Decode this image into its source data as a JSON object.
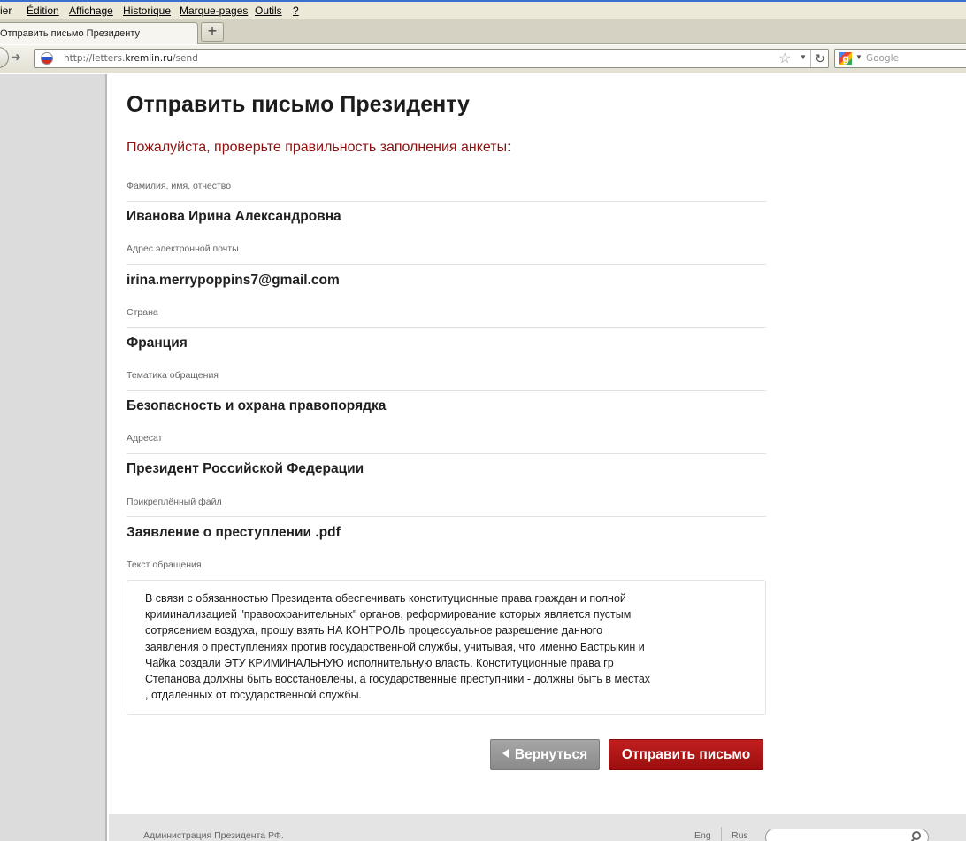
{
  "browser": {
    "menu": [
      "ier",
      "Édition",
      "Affichage",
      "Historique",
      "Marque-pages",
      "Outils",
      "?"
    ],
    "tab_title": "Отправить письмо Президенту",
    "new_tab_label": "+",
    "url_prefix": "http://letters.",
    "url_domain": "kremlin.ru",
    "url_path": "/send",
    "search_placeholder": "Google",
    "site_flag_colors": [
      "#ffffff",
      "#2a56c6",
      "#d52b1e"
    ]
  },
  "page": {
    "title": "Отправить письмо Президенту",
    "notice": "Пожалуйста, проверьте правильность заполнения анкеты:",
    "fields": [
      {
        "label": "Фамилия, имя, отчество",
        "value": "Иванова Ирина Александровна"
      },
      {
        "label": "Адрес электронной почты",
        "value": "irina.merrypoppins7@gmail.com"
      },
      {
        "label": "Страна",
        "value": "Франция"
      },
      {
        "label": "Тематика обращения",
        "value": "Безопасность и охрана правопорядка"
      },
      {
        "label": "Адресат",
        "value": "Президент Российской Федерации"
      },
      {
        "label": "Прикреплённый файл",
        "value": "Заявление о преступлении .pdf"
      }
    ],
    "message_label": "Текст обращения",
    "message_text": "В связи  с  обязанностью Президента  обеспечивать конституционные  права  граждан и полной\nкриминализацией  \"правоохранительных\"  органов,  реформирование  которых является  пустым\nсотрясением воздуха,   прошу  взять  НА КОНТРОЛЬ процессуальное  разрешение  данного\nзаявления о  преступлениях против государственной  службы,  учитывая, что именно  Бастрыкин и\nЧайка  создали  ЭТУ  КРИМИНАЛЬНУЮ исполнительную власть.  Конституционные  права  гр\nСтепанова  должны быть  восстановлены,  а государственные  преступники - должны быть в  местах\n, отдалённых  от  государственной  службы.",
    "back_button": "Вернуться",
    "send_button": "Отправить письмо"
  },
  "footer": {
    "admin": "Администрация Президента РФ.",
    "lang_eng": "Eng",
    "lang_rus": "Rus"
  },
  "colors": {
    "accent_red": "#8f0f0f",
    "send_button": "#b01616",
    "back_button": "#999999"
  }
}
